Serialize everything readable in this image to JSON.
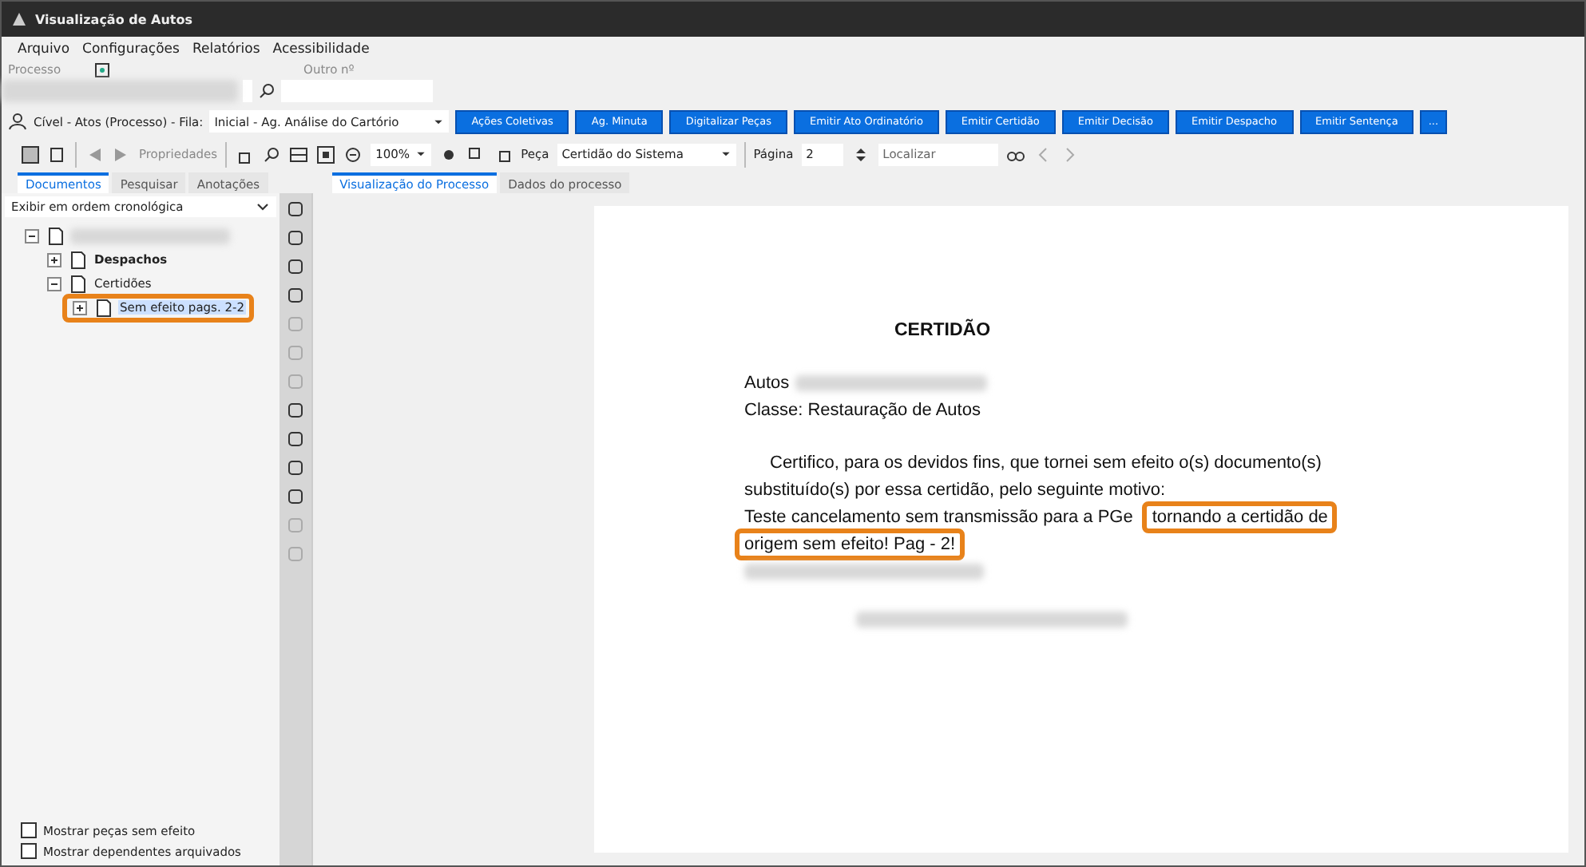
{
  "window": {
    "title": "Visualização de Autos"
  },
  "menu": [
    "Arquivo",
    "Configurações",
    "Relatórios",
    "Acessibilidade"
  ],
  "search_row": {
    "process_label": "Processo",
    "other_label": "Outro nº"
  },
  "action_bar": {
    "context": "Cível - Atos (Processo) - Fila:",
    "queue": "Inicial - Ag. Análise do Cartório",
    "buttons": [
      "Ações Coletivas",
      "Ag. Minuta",
      "Digitalizar Peças",
      "Emitir Ato Ordinatório",
      "Emitir Certidão",
      "Emitir Decisão",
      "Emitir Despacho",
      "Emitir Sentença",
      "..."
    ]
  },
  "viewer_toolbar": {
    "properties": "Propriedades",
    "zoom": "100%",
    "piece_label": "Peça",
    "piece": "Certidão do Sistema",
    "page_label": "Página",
    "page": "2",
    "find_placeholder": "Localizar"
  },
  "left_tabs": [
    {
      "label": "Documentos",
      "selected": true
    },
    {
      "label": "Pesquisar",
      "selected": false
    },
    {
      "label": "Anotações",
      "selected": false
    }
  ],
  "view_tabs": [
    {
      "label": "Visualização do Processo",
      "selected": true
    },
    {
      "label": "Dados do processo",
      "selected": false
    }
  ],
  "order": "Exibir em ordem cronológica",
  "tree": [
    {
      "expanded": true,
      "bold": false,
      "selected": false,
      "highlighted": false,
      "children": [
        {
          "label": "Despachos",
          "expanded": false,
          "bold": true,
          "selected": false,
          "highlighted": false
        },
        {
          "label": "Certidões",
          "expanded": true,
          "bold": false,
          "selected": false,
          "highlighted": false,
          "children": [
            {
              "label": "Sem efeito pags. 2-2",
              "expanded": false,
              "bold": false,
              "selected": true,
              "highlighted": true
            }
          ]
        }
      ]
    }
  ],
  "options": [
    {
      "label": "Mostrar peças sem efeito",
      "checked": false
    },
    {
      "label": "Mostrar dependentes arquivados",
      "checked": false
    }
  ],
  "document": {
    "title": "CERTIDÃO",
    "autos_label": "Autos",
    "classe": "Classe: Restauração de Autos",
    "lines": [
      [
        {
          "text": "Certifico, para os devidos fins, que tornei sem efeito o(s) documento(s)",
          "highlighted": false
        }
      ],
      [
        {
          "text": "substituído(s) por essa certidão, pelo seguinte motivo:",
          "highlighted": false
        }
      ],
      [
        {
          "text": "Teste cancelamento sem transmissão para a PGe",
          "highlighted": false
        },
        {
          "text": "tornando a certidão de",
          "highlighted": true
        }
      ],
      [
        {
          "text": "origem sem efeito! Pag - 2!",
          "highlighted": true
        }
      ]
    ]
  }
}
